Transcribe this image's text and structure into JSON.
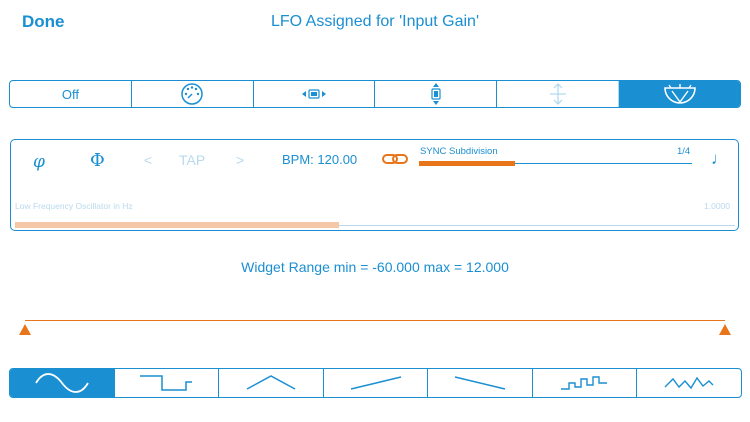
{
  "header": {
    "done_label": "Done",
    "title": "LFO Assigned for 'Input Gain'"
  },
  "mode_bar": {
    "items": [
      {
        "label": "Off",
        "icon": ""
      },
      {
        "label": "",
        "icon": "knob-icon"
      },
      {
        "label": "",
        "icon": "horizontal-pan-icon"
      },
      {
        "label": "",
        "icon": "vertical-slider-icon"
      },
      {
        "label": "",
        "icon": "vertical-arrows-icon"
      },
      {
        "label": "",
        "icon": "meter-dial-icon"
      }
    ],
    "selected_index": 5
  },
  "lfo_panel": {
    "phase_italic": "φ",
    "phase_upper": "Φ",
    "prev": "<",
    "tap": "TAP",
    "next": ">",
    "bpm": "BPM: 120.00",
    "sync_label": "SYNC Subdivision",
    "sync_value": "1/4",
    "sync_fraction": 0.35,
    "note": "♩",
    "lfo_label": "Low Frequency Oscillator in Hz",
    "lfo_value": "1.0000",
    "lfo_fraction": 0.45
  },
  "range_text": "Widget Range min = -60.000 max = 12.000",
  "waveforms": {
    "items": [
      "sine-wave-icon",
      "square-wave-icon",
      "triangle-wave-icon",
      "ramp-up-icon",
      "ramp-down-icon",
      "stepped-random-icon",
      "noise-wave-icon"
    ],
    "selected_index": 0
  },
  "colors": {
    "accent": "#1a8fd1",
    "orange": "#e8751a",
    "light": "#b9d9ee",
    "peach": "#f5c8a8"
  }
}
